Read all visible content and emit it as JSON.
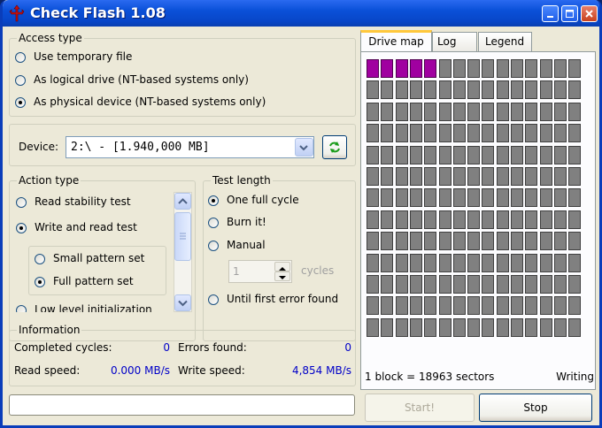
{
  "window": {
    "title": "Check Flash 1.08",
    "minimize_icon": "minimize-icon",
    "maximize_icon": "maximize-icon",
    "close_icon": "close-icon"
  },
  "access_type": {
    "legend": "Access type",
    "options": [
      "Use temporary file",
      "As logical drive (NT-based systems only)",
      "As physical device (NT-based systems only)"
    ],
    "selected": 2
  },
  "device": {
    "label": "Device:",
    "value": "2:\\ - [1.940,000 MB]",
    "refresh_icon": "refresh-icon"
  },
  "action_type": {
    "legend": "Action type",
    "options": [
      "Read stability test",
      "Write and read test",
      "Low level initialization"
    ],
    "selected": 1,
    "sub_options": [
      "Small pattern set",
      "Full pattern set"
    ],
    "sub_selected": 1
  },
  "test_length": {
    "legend": "Test length",
    "options": [
      "One full cycle",
      "Burn it!",
      "Manual",
      "Until first error found"
    ],
    "selected": 0,
    "manual_value": "1",
    "manual_unit": "cycles"
  },
  "information": {
    "legend": "Information",
    "completed_cycles_label": "Completed cycles:",
    "completed_cycles": "0",
    "errors_found_label": "Errors found:",
    "errors_found": "0",
    "read_speed_label": "Read speed:",
    "read_speed": "0.000 MB/s",
    "write_speed_label": "Write speed:",
    "write_speed": "4,854 MB/s"
  },
  "progress": 0,
  "tabs": [
    "Drive map",
    "Log",
    "Legend"
  ],
  "active_tab": 0,
  "drive_map": {
    "columns": 15,
    "rows": 13,
    "completed_blocks": 5,
    "colors": {
      "done": "#a000a0",
      "pending": "#808080"
    }
  },
  "status": {
    "block_info": "1 block = 18963 sectors",
    "state": "Writing"
  },
  "buttons": {
    "start": "Start!",
    "stop": "Stop"
  }
}
